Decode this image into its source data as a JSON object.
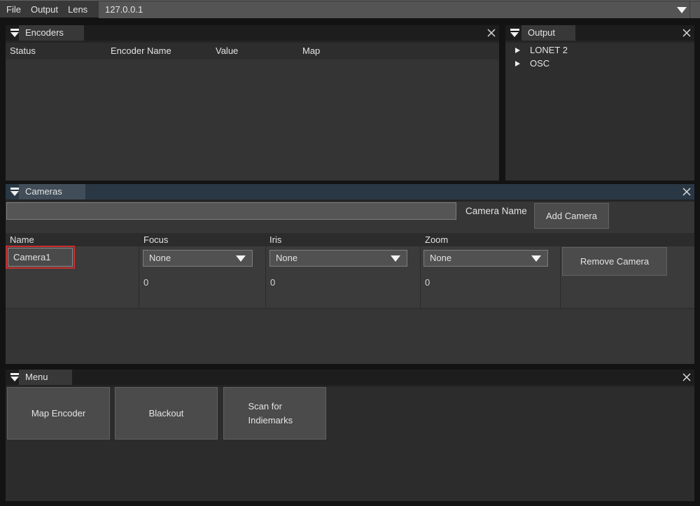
{
  "menubar": {
    "items": [
      "File",
      "Output",
      "Lens"
    ],
    "address": "127.0.0.1"
  },
  "panels": {
    "encoders": {
      "title": "Encoders",
      "columns": [
        "Status",
        "Encoder Name",
        "Value",
        "Map"
      ]
    },
    "output": {
      "title": "Output",
      "tree": [
        "LONET 2",
        "OSC"
      ]
    },
    "cameras": {
      "title": "Cameras",
      "name_label": "Camera Name",
      "add_button": "Add Camera",
      "columns": [
        "Name",
        "Focus",
        "Iris",
        "Zoom"
      ],
      "row": {
        "name": "Camera1",
        "focus": "None",
        "iris": "None",
        "zoom": "None",
        "focus_value": "0",
        "iris_value": "0",
        "zoom_value": "0",
        "remove_button": "Remove Camera"
      }
    },
    "menu": {
      "title": "Menu",
      "buttons": [
        "Map Encoder",
        "Blackout",
        "Scan for Indiemarks"
      ]
    }
  },
  "colors": {
    "accent_red": "#c92f2f",
    "active_panel_header": "#2a3845"
  }
}
